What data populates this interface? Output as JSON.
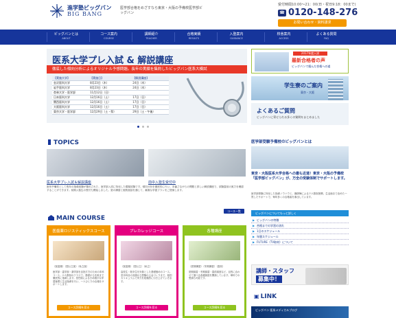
{
  "header": {
    "logo_jp": "進学塾ビッグバン",
    "logo_en": "BIG BANG",
    "tagline": "医学部合格をめざすなら東京・大阪の予備校医学部ビッグバン",
    "hours": "受付時間10:00～21：00(日・祝日9:18：00まで)",
    "phone_icon": "☎",
    "phone": "0120-148-276",
    "contact_label": "お問い合わせ・資料請求"
  },
  "nav": [
    {
      "jp": "ビッグバンとは",
      "en": "ABOUT"
    },
    {
      "jp": "コース案内",
      "en": "COURSE"
    },
    {
      "jp": "講師紹介",
      "en": "TEACHER"
    },
    {
      "jp": "合格実績",
      "en": "RESULTS"
    },
    {
      "jp": "入塾案内",
      "en": "GUIDANCE"
    },
    {
      "jp": "校舎案内",
      "en": "ACCESS"
    },
    {
      "jp": "よくある質問",
      "en": "FAQ"
    }
  ],
  "hero": {
    "title": "医系大学プレ入試 & 解説講座",
    "subtitle": "徹底した傾向分析によるオリジナル予想問題。長年の実績を集約したビッグバン医系大模試",
    "table_head": [
      "【実施大学】",
      "【実施日】",
      "【解説講座】"
    ],
    "rows": [
      [
        "金沢医科大学",
        "8月23日（木）",
        "24日（木）"
      ],
      [
        "岩手医科大学",
        "8月23日（木）",
        "24日（木）"
      ],
      [
        "杏林大学・医学部",
        "11月12日（日）",
        ""
      ],
      [
        "日本医科大学",
        "12月16日（土）",
        "17日（日）"
      ],
      [
        "関西医科大学",
        "12月16日（土）",
        "17日（日）"
      ],
      [
        "大阪医科大学",
        "12月16日（土）",
        "17日（日）"
      ],
      [
        "東京大学・医学部",
        "12月29日（土・祭）",
        "29日（土・午後）"
      ]
    ]
  },
  "side_banners": {
    "pass": {
      "tag": "2017年度入試",
      "big": "最新合格者の声",
      "small": "ビッグバンで掴んだ合格への道"
    },
    "dorm": {
      "title": "学生寮のご案内",
      "sub": "東京・大阪"
    },
    "faq": {
      "title": "よくあるご質問",
      "sub": "ビッグバンに寄せられる多くの質問をまとめました"
    }
  },
  "topics": {
    "heading": "TOPICS",
    "items": [
      {
        "caption": "医系大学プレ入試＆解説講座"
      },
      {
        "caption": "前中入塾生受付中"
      }
    ],
    "body": "医系予備校として長年の指導経験が集約された、医学部入試に特化した模擬試験です。傾向分析を徹底的に行い、本番さながらの問題と詳しい解説講座で、試験直前の実力を確認することができます。前期入塾生の受付も開始しました。夏の講習と個別面談を通じて、最適な学習プランをご提案します。",
    "more": "コース一覧"
  },
  "main_course": {
    "heading": "MAIN COURSE",
    "courses": [
      {
        "title": "医歯薬ロジスティックスコース",
        "color": "#f39800",
        "label": "（医歯薬）（国公立医）（私立医）",
        "text": "医学部・歯学部・薬学部を目指す方のための本科コース。少人数制のクラスで、基礎から応用まで徹底的に指導します。担任制によるきめ細かな学習管理と生活指導を行い、一人ひとりの合格をサポートします。",
        "btn": "コース詳細を見る"
      },
      {
        "title": "プレカレッジコース",
        "color": "#e4007f",
        "label": "（医歯薬）（国公立）（私立）",
        "text": "高校生・既卒生を対象とした基礎固めのコース。苦手科目の克服から受験の土台づくりまで、個別カリキュラムで学力を段階的に引き上げていきます。",
        "btn": "コース詳細を見る"
      },
      {
        "title": "各種講座",
        "color": "#8fc31f",
        "label": "（夏期講習）（冬期講習）（直前）",
        "text": "夏期講習・冬期講習・直前講座など、目的に合わせて選べる各種講座を開講しています。単科での受講も可能です。",
        "btn": "コース詳細を見る"
      }
    ]
  },
  "right_panel": {
    "title": "医学部受験予備校のビッグバンとは",
    "lead": "東京・大阪医系大学合格への最も近道！東京・大阪の予備校「医学部ビッグバン」が、万全の受験体制でサポートします。",
    "body": "医学部受験に特化した指導ノウハウと、講師陣による少人数制授業。生活面まで含めた一貫したサポートで、毎年多くの合格者を輩出しています。",
    "button": "ビッグバンについてもっと詳しく",
    "links": [
      "ビッグバンの特徴",
      "合格までの学習の流れ",
      "1日のスケジュール",
      "年間スケジュール",
      "FUTURE（TV取材）について"
    ]
  },
  "recruit": {
    "line1": "講師・スタッフ",
    "line2": "募集中！"
  },
  "link_section": {
    "mark": "▣",
    "heading": "LINK",
    "banner": "ビッグバン 医系メディカルブログ"
  }
}
